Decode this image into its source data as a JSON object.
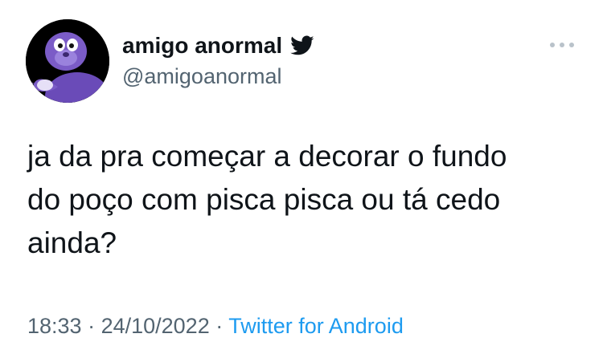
{
  "author": {
    "display_name": "amigo anormal",
    "handle": "@amigoanormal",
    "verified_icon": "twitter-bird-icon",
    "avatar_icon": "purple-character-avatar"
  },
  "tweet": {
    "text": "ja da pra começar a decorar o fundo\ndo poço com pisca pisca ou tá cedo\nainda?"
  },
  "meta": {
    "time": "18:33",
    "separator": " · ",
    "date": "24/10/2022",
    "source": "Twitter for Android"
  },
  "colors": {
    "text": "#0f1419",
    "secondary": "#536471",
    "accent": "#1d9bf0",
    "more_dots": "#b9c2ca",
    "avatar_purple": "#7b5cc7"
  },
  "more_icon": "more-options-icon"
}
